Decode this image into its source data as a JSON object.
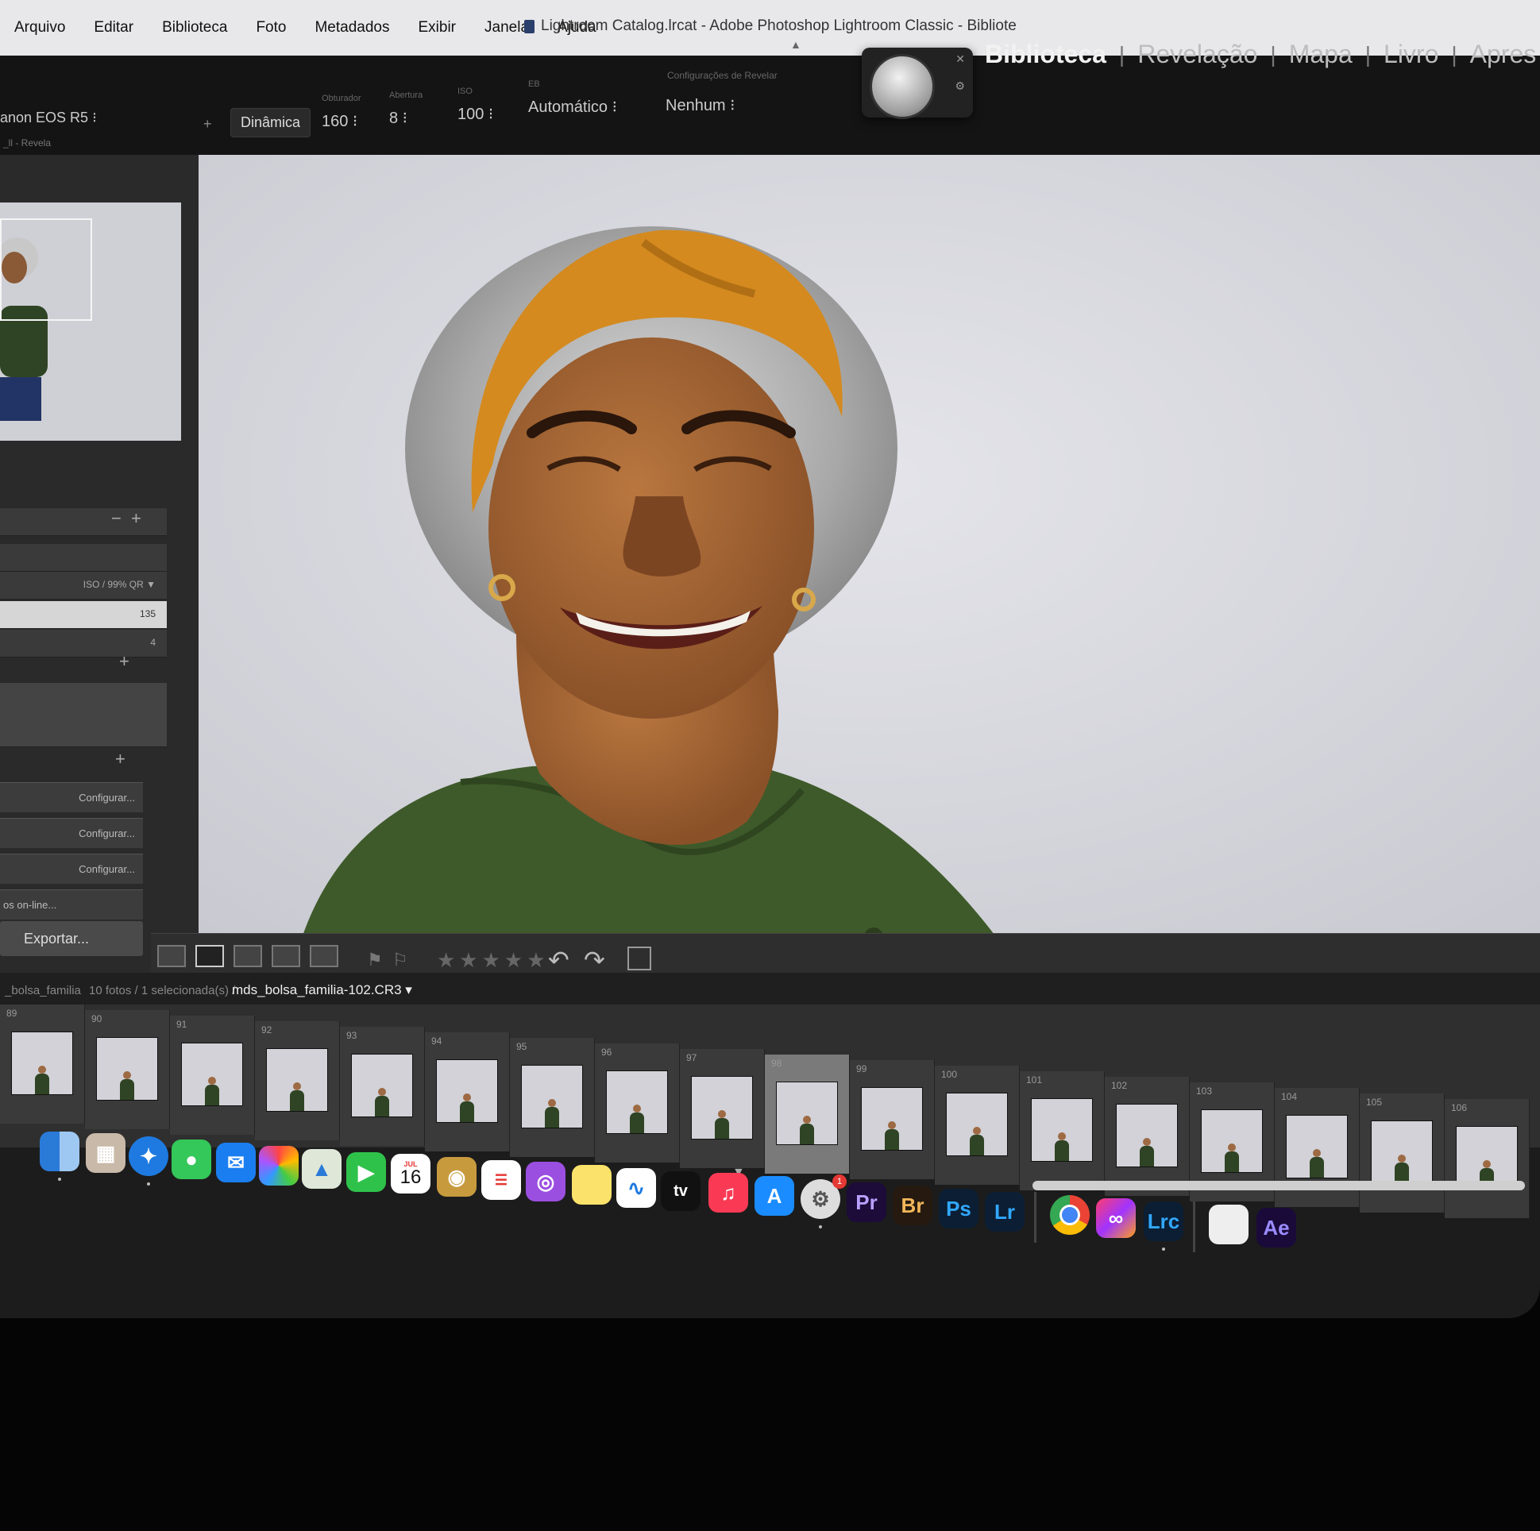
{
  "menubar": {
    "items": [
      "Arquivo",
      "Editar",
      "Biblioteca",
      "Foto",
      "Metadados",
      "Exibir",
      "Janela",
      "Ajuda"
    ],
    "window_title": "Lightroom Catalog.lrcat - Adobe Photoshop Lightroom Classic - Bibliote"
  },
  "identity": {
    "camera": "anon EOS R5 ⁝",
    "sub": "_ll - Revela"
  },
  "capture_settings": {
    "dinamica": "Dinâmica",
    "shutter_label": "Obturador",
    "shutter": "160 ⁝",
    "aperture_label": "Abertura",
    "aperture": "8 ⁝",
    "iso_label": "ISO",
    "iso": "100 ⁝",
    "wb_label": "EB",
    "wb": "Automático ⁝",
    "preset_label": "Configurações de Revelar",
    "preset": "Nenhum ⁝"
  },
  "modules": {
    "items": [
      "Biblioteca",
      "Revelação",
      "Mapa",
      "Livro",
      "Apres"
    ],
    "active": "Biblioteca"
  },
  "left_panel": {
    "row_right_1": "ISO / 99% QR ▼",
    "row_right_2": "135",
    "row_right_3": "4",
    "configurar_1": "Configurar...",
    "configurar_2": "Configurar...",
    "configurar_3": "Configurar...",
    "online": "os on-line...",
    "export": "Exportar..."
  },
  "toolbar": {
    "stars": "★★★★★"
  },
  "filmstrip": {
    "path_prefix": "_bolsa_familia",
    "path_middle": "10 fotos / 1 selecionada(s) /",
    "filename": "mds_bolsa_familia-102.CR3 ▾",
    "selected_number": "98",
    "numbers": [
      "89",
      "90",
      "91",
      "92",
      "93",
      "94",
      "95",
      "96",
      "97",
      "98",
      "99",
      "100",
      "101",
      "102",
      "103",
      "104",
      "105",
      "106"
    ]
  },
  "dock": {
    "calendar_day": "16",
    "calendar_month": "JUL",
    "badge": "1",
    "pr": "Pr",
    "br": "Br",
    "ps": "Ps",
    "lr": "Lr",
    "lrc": "Lrc",
    "ae": "Ae",
    "tv": "tv"
  },
  "colors": {
    "lr_panel": "#2a2a2a",
    "background_gray": "#d8d8de",
    "headband_orange": "#d48a1f",
    "shirt_green": "#3e5a2a",
    "adobe_blue": "#2d8cff"
  }
}
